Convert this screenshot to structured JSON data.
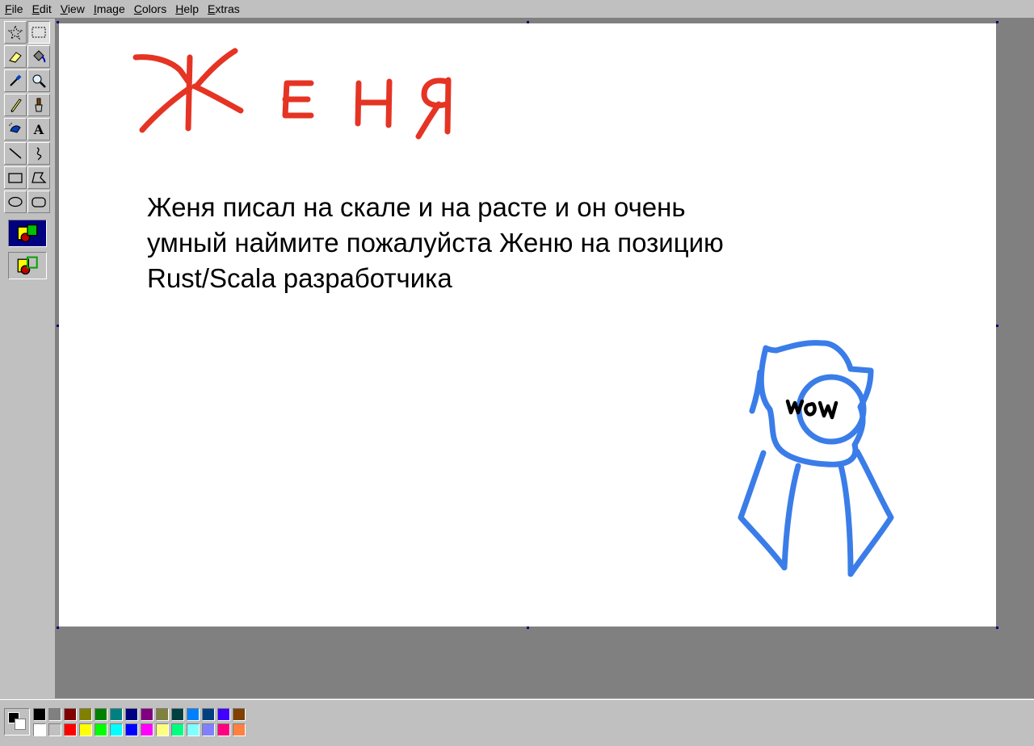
{
  "menu": {
    "items": [
      {
        "label": "File",
        "key": "file",
        "underline": "F",
        "rest": "ile"
      },
      {
        "label": "Edit",
        "key": "edit",
        "underline": "E",
        "rest": "dit"
      },
      {
        "label": "View",
        "key": "view",
        "underline": "V",
        "rest": "iew"
      },
      {
        "label": "Image",
        "key": "image",
        "underline": "I",
        "rest": "mage"
      },
      {
        "label": "Colors",
        "key": "colors",
        "underline": "C",
        "rest": "olors"
      },
      {
        "label": "Help",
        "key": "help",
        "underline": "H",
        "rest": "elp"
      },
      {
        "label": "Extras",
        "key": "extras",
        "underline": "E",
        "rest": "xtras"
      }
    ]
  },
  "toolbox": {
    "tools": [
      {
        "name": "free-form-select-tool",
        "icon": "star-select-icon"
      },
      {
        "name": "rectangle-select-tool",
        "icon": "rect-select-icon",
        "active": true
      },
      {
        "name": "eraser-tool",
        "icon": "eraser-icon"
      },
      {
        "name": "fill-tool",
        "icon": "paint-bucket-icon"
      },
      {
        "name": "pick-color-tool",
        "icon": "eyedropper-icon"
      },
      {
        "name": "magnifier-tool",
        "icon": "magnifier-icon"
      },
      {
        "name": "pencil-tool",
        "icon": "pencil-icon"
      },
      {
        "name": "brush-tool",
        "icon": "brush-icon"
      },
      {
        "name": "airbrush-tool",
        "icon": "airbrush-icon"
      },
      {
        "name": "text-tool",
        "icon": "text-icon",
        "glyph": "A"
      },
      {
        "name": "line-tool",
        "icon": "line-icon"
      },
      {
        "name": "curve-tool",
        "icon": "curve-icon"
      },
      {
        "name": "rectangle-tool",
        "icon": "rectangle-icon"
      },
      {
        "name": "polygon-tool",
        "icon": "polygon-icon"
      },
      {
        "name": "ellipse-tool",
        "icon": "ellipse-icon"
      },
      {
        "name": "rounded-rectangle-tool",
        "icon": "rounded-rectangle-icon"
      }
    ],
    "options": [
      {
        "name": "opaque-option",
        "icon": "opaque-shapes-icon",
        "selected": true
      },
      {
        "name": "transparent-option",
        "icon": "transparent-shapes-icon",
        "selected": false
      }
    ]
  },
  "canvas": {
    "heading_drawing": "Женя",
    "body_text": "Женя писал на скале и на расте и он очень умный наймите пожалуйста Женю на позицию Rust/Scala разработчика",
    "badge_text": "wow",
    "heading_color": "#e53424",
    "badge_color": "#3b7de8"
  },
  "colors": {
    "foreground": "#000000",
    "background": "#ffffff",
    "palette_top": [
      "#000000",
      "#808080",
      "#800000",
      "#808000",
      "#008000",
      "#008080",
      "#000080",
      "#800080",
      "#808040",
      "#004040",
      "#0080ff",
      "#004080",
      "#4000ff",
      "#804000"
    ],
    "palette_bottom": [
      "#ffffff",
      "#c0c0c0",
      "#ff0000",
      "#ffff00",
      "#00ff00",
      "#00ffff",
      "#0000ff",
      "#ff00ff",
      "#ffff80",
      "#00ff80",
      "#80ffff",
      "#8080ff",
      "#ff0080",
      "#ff8040"
    ]
  }
}
